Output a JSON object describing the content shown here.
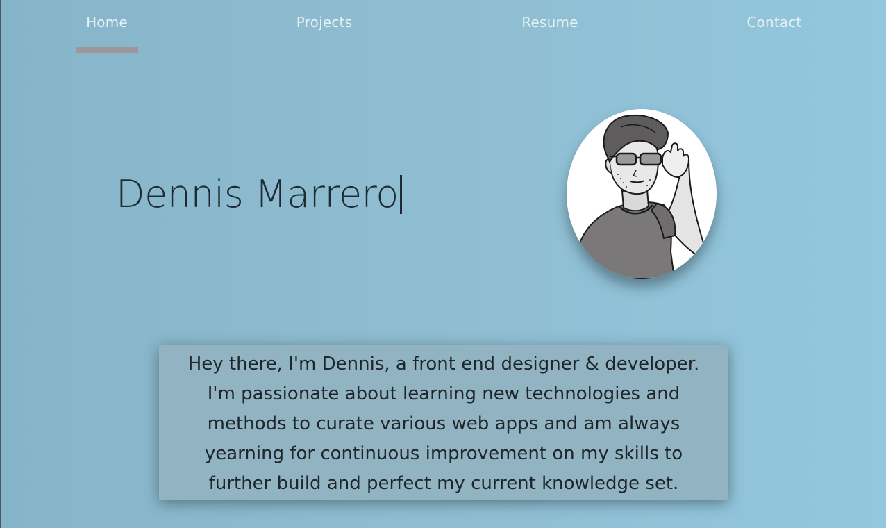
{
  "nav": {
    "items": [
      {
        "label": "Home",
        "active": true
      },
      {
        "label": "Projects",
        "active": false
      },
      {
        "label": "Resume",
        "active": false
      },
      {
        "label": "Contact",
        "active": false
      }
    ],
    "indicator_color": "#9d979c"
  },
  "hero": {
    "name": "Dennis Marrero",
    "avatar_icon": "cartoon-portrait-adjusting-glasses"
  },
  "bio": {
    "lines": [
      "Hey there, I'm Dennis, a front end designer & developer.",
      "I'm passionate about learning new technologies and",
      "methods to curate various web apps and am always",
      "yearning for continuous improvement on my skills to",
      "further build and perfect my current knowledge set."
    ]
  },
  "colors": {
    "background": "#8fbdd1",
    "nav_text": "#e6f0f5",
    "card_background": "#92b3c1",
    "text_dark": "#1f2a30"
  }
}
